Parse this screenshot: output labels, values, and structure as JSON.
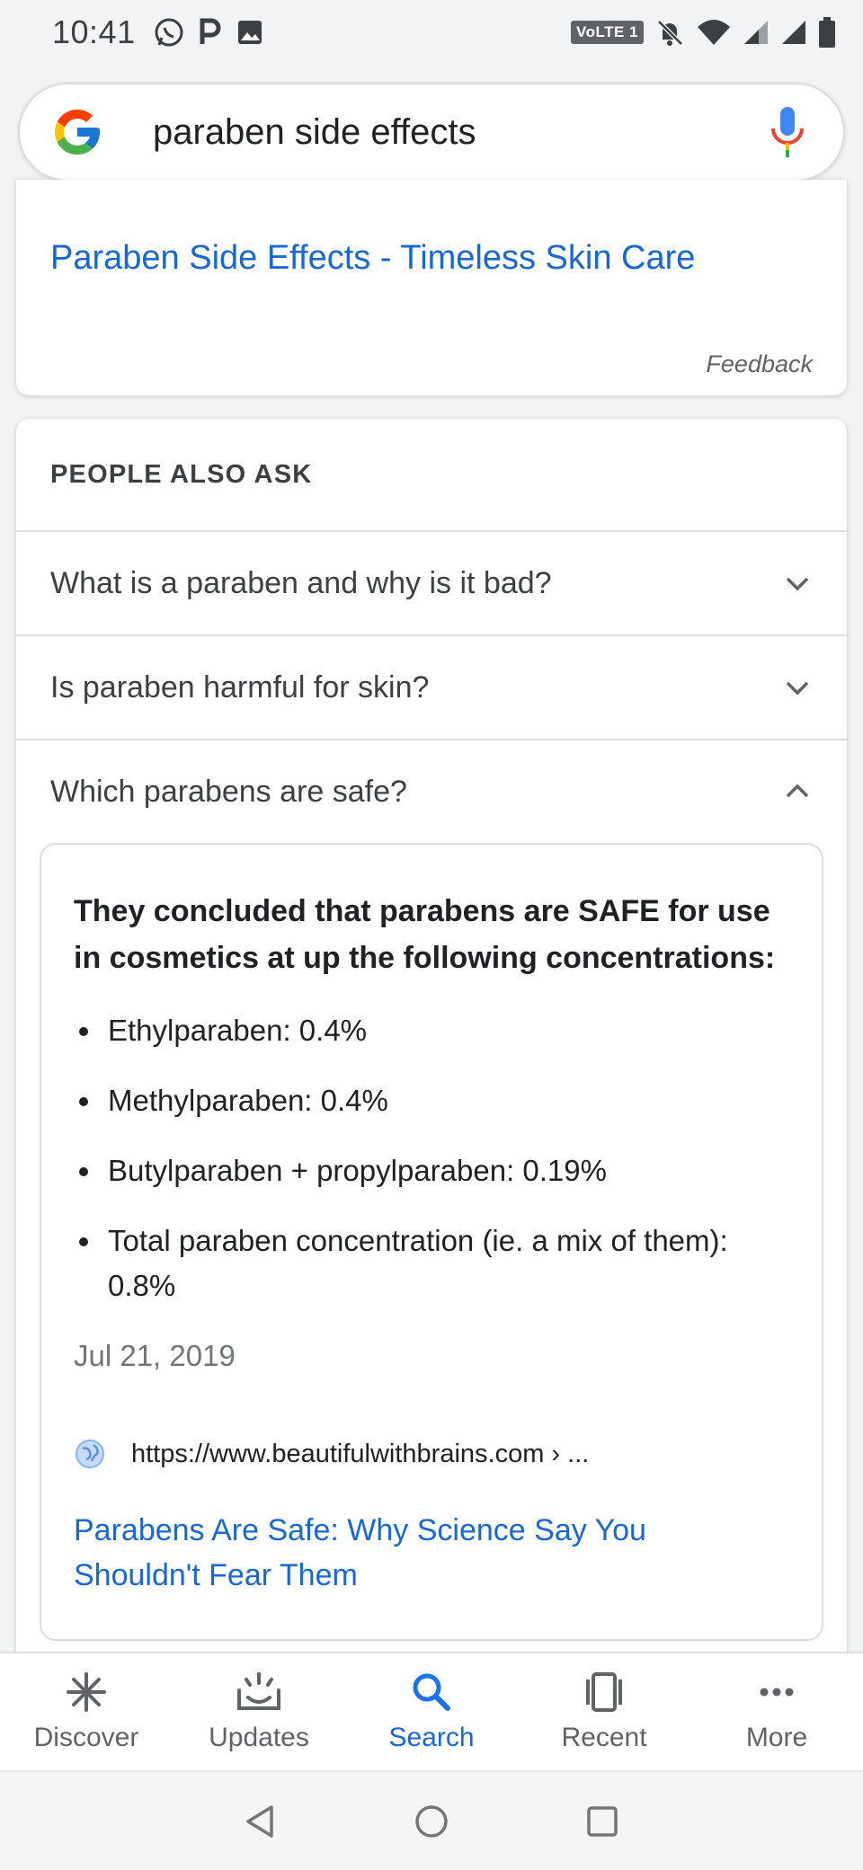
{
  "status_bar": {
    "time": "10:41",
    "left_icons": [
      "whatsapp-icon",
      "parking-p-icon",
      "image-icon"
    ],
    "volte_label": "VoLTE 1",
    "right_icons": [
      "mute-bell-icon",
      "wifi-icon",
      "signal-icon",
      "signal-icon",
      "battery-icon"
    ]
  },
  "search": {
    "query": "paraben side effects",
    "logo": "google-g-logo",
    "mic_icon": "mic-icon"
  },
  "top_result": {
    "title": "Paraben Side Effects - Timeless Skin Care",
    "feedback": "Feedback"
  },
  "people_also_ask": {
    "heading": "PEOPLE ALSO ASK",
    "questions": [
      {
        "text": "What is a paraben and why is it bad?",
        "expanded": false
      },
      {
        "text": "Is paraben harmful for skin?",
        "expanded": false
      },
      {
        "text": "Which parabens are safe?",
        "expanded": true
      }
    ],
    "answer": {
      "lead": "They concluded that parabens are SAFE for use in cosmetics at up the following concentrations:",
      "bullets": [
        "Ethylparaben: 0.4%",
        "Methylparaben: 0.4%",
        "Butylparaben + propylparaben: 0.19%",
        "Total paraben concentration (ie. a mix of them): 0.8%"
      ],
      "date": "Jul 21, 2019",
      "source_url": "https://www.beautifulwithbrains.com › ...",
      "source_title": "Parabens Are Safe: Why Science Say You Shouldn't Fear Them"
    }
  },
  "bottom_nav": {
    "items": [
      {
        "label": "Discover",
        "icon": "asterisk-icon",
        "active": false
      },
      {
        "label": "Updates",
        "icon": "updates-icon",
        "active": false
      },
      {
        "label": "Search",
        "icon": "search-icon",
        "active": true
      },
      {
        "label": "Recent",
        "icon": "recent-icon",
        "active": false
      },
      {
        "label": "More",
        "icon": "more-icon",
        "active": false
      }
    ]
  },
  "colors": {
    "link": "#1967d2",
    "accent": "#1a73e8",
    "text": "#202124",
    "muted": "#5f6368"
  }
}
